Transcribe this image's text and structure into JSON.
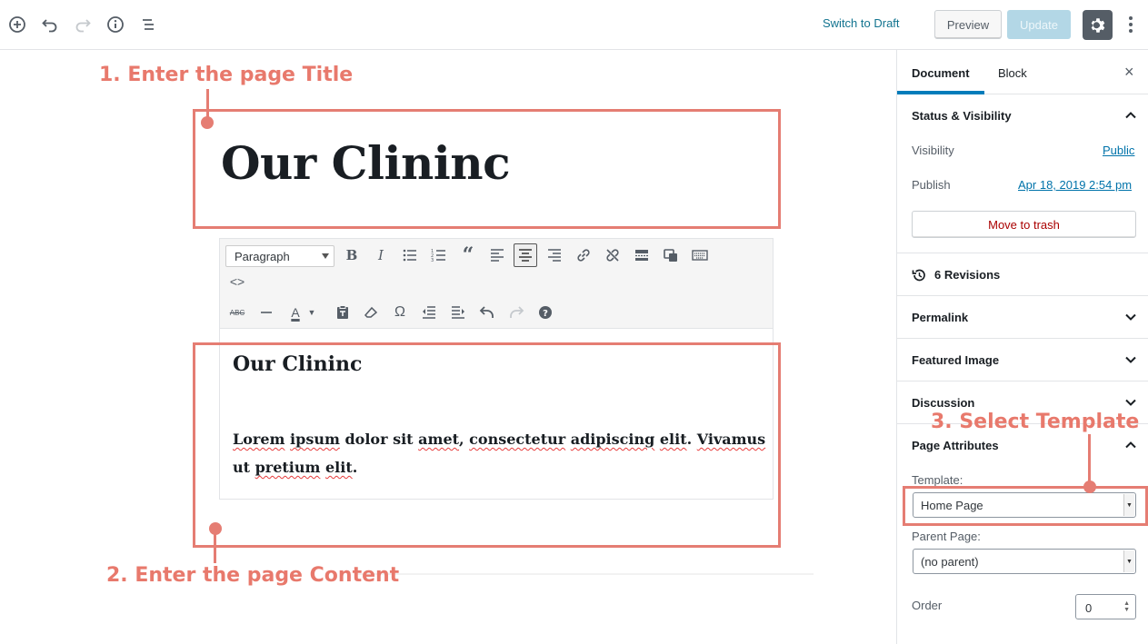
{
  "topbar": {
    "switch_draft": "Switch to Draft",
    "preview": "Preview",
    "update": "Update"
  },
  "sidebar": {
    "tabs": [
      "Document",
      "Block"
    ],
    "close": "×",
    "status_visibility": {
      "title": "Status & Visibility",
      "visibility_label": "Visibility",
      "visibility_value": "Public",
      "publish_label": "Publish",
      "publish_value": "Apr 18, 2019 2:54 pm",
      "move_to_trash": "Move to trash"
    },
    "revisions": "6 Revisions",
    "permalink": "Permalink",
    "featured_image": "Featured Image",
    "discussion": "Discussion",
    "page_attributes": {
      "title": "Page Attributes",
      "template_label": "Template:",
      "template_value": "Home Page",
      "parent_label": "Parent Page:",
      "parent_value": "(no parent)",
      "order_label": "Order",
      "order_value": "0"
    }
  },
  "editor": {
    "title": "Our Clininc",
    "format_select": "Paragraph",
    "content_heading": "Our Clininc",
    "content_words": [
      "Lorem",
      "ipsum",
      "dolor sit",
      "amet",
      ", ",
      "consectetur",
      "adipiscing",
      "elit",
      ". ",
      "Vivamus",
      " ut ",
      "pretium",
      "elit",
      "."
    ]
  },
  "annotations": {
    "step1": "1. Enter the page Title",
    "step2": "2. Enter the page Content",
    "step3": "3. Select Template"
  },
  "colors": {
    "annotation": "#e57d73",
    "link": "#0073aa",
    "accent": "#007cba",
    "trash": "#aa0000"
  }
}
